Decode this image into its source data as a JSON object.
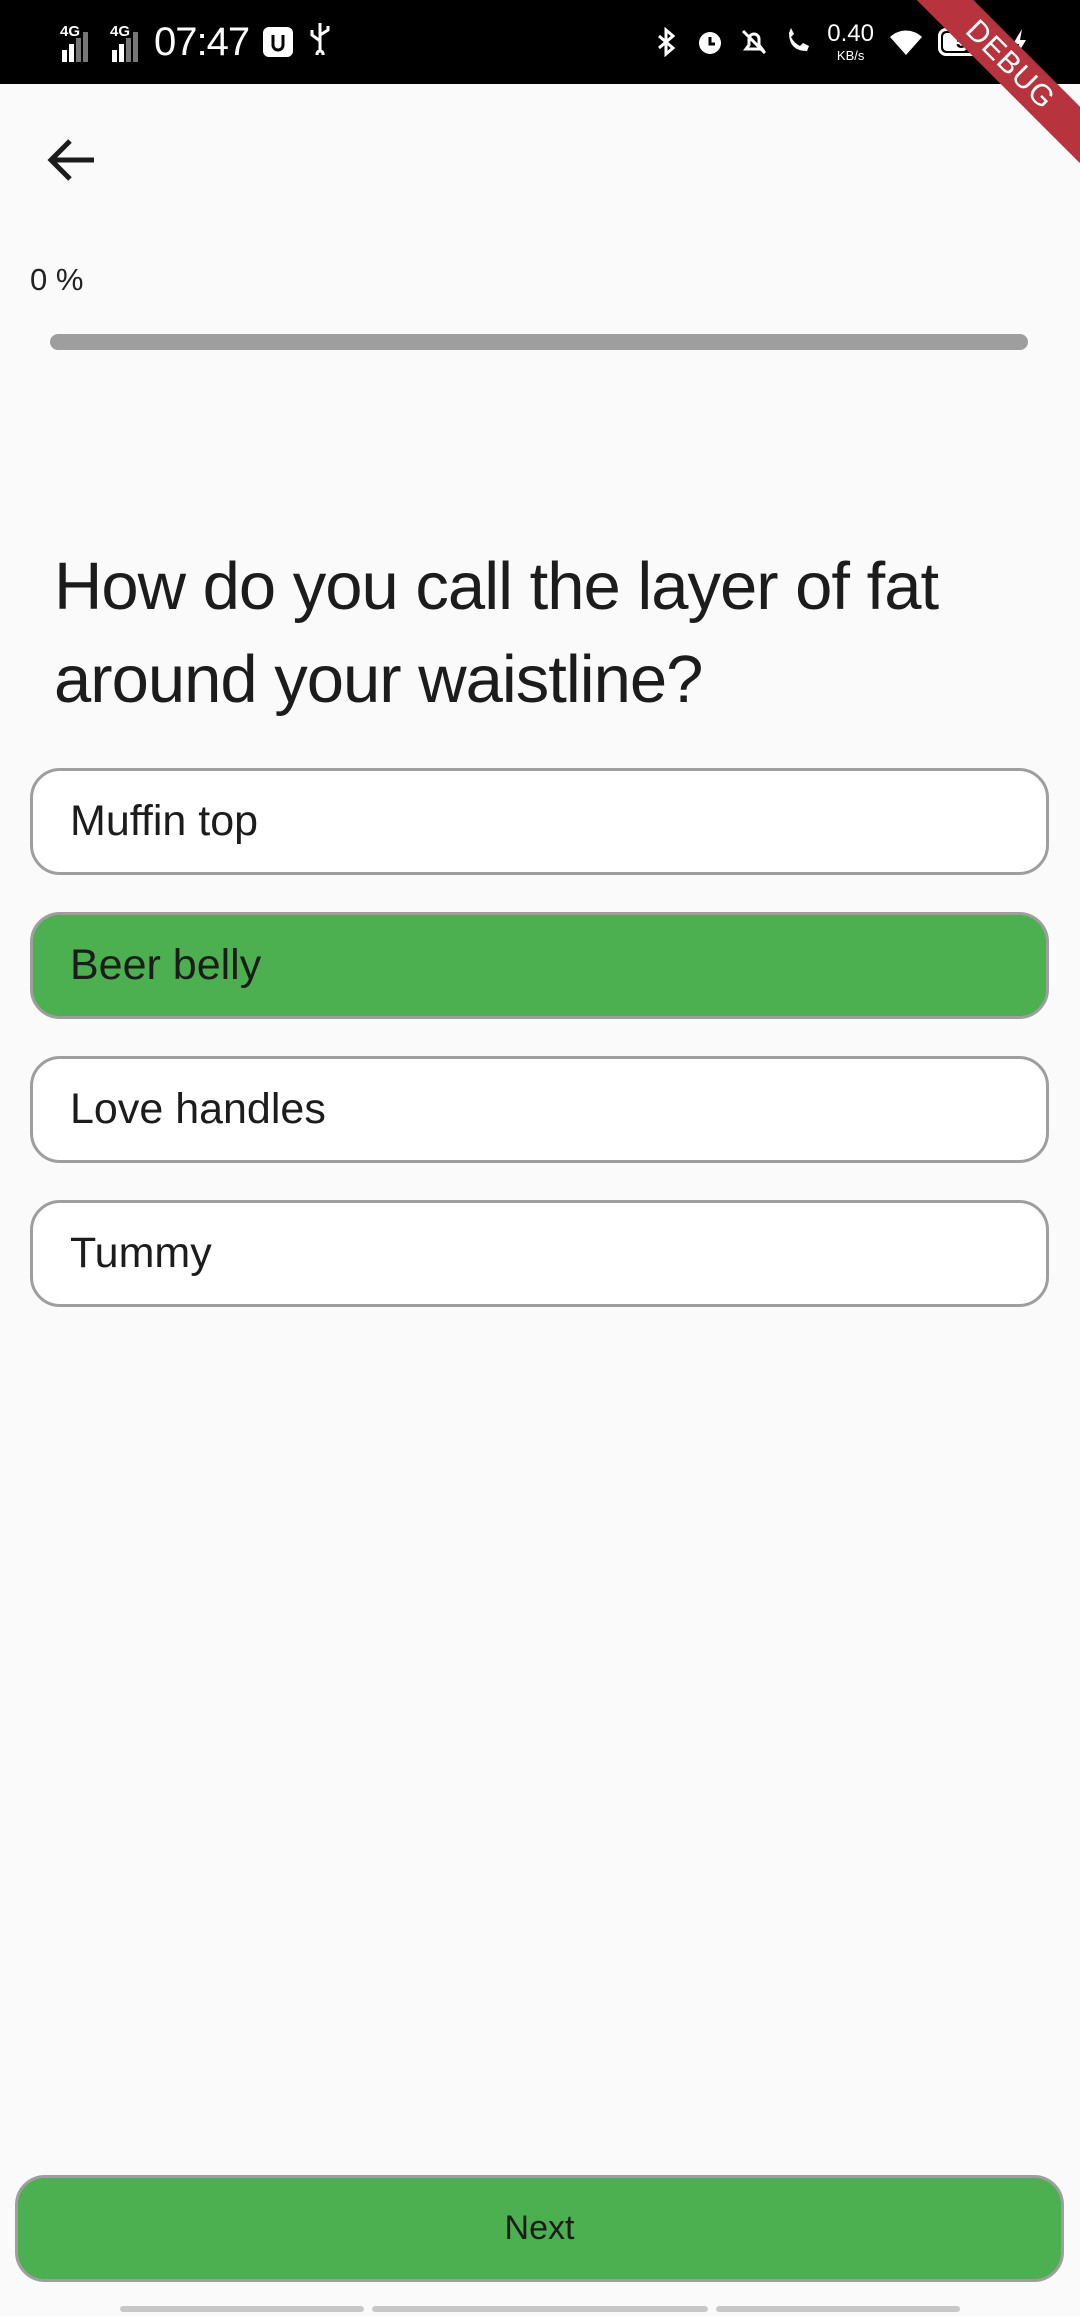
{
  "status_bar": {
    "sim1_network": "4G",
    "sim2_network": "4G",
    "time": "07:47",
    "net_speed_value": "0.40",
    "net_speed_unit": "KB/s",
    "battery_level": "54",
    "battery_fraction": 0.54
  },
  "debug_banner": {
    "label": "DEBUG"
  },
  "header": {
    "progress_label": "0 %",
    "progress_fraction": 0
  },
  "question": {
    "text": "How do you call the layer of fat around your waistline?"
  },
  "options": [
    {
      "label": "Muffin top",
      "selected": false
    },
    {
      "label": "Beer belly",
      "selected": true
    },
    {
      "label": "Love handles",
      "selected": false
    },
    {
      "label": "Tummy",
      "selected": false
    }
  ],
  "footer": {
    "next_label": "Next"
  },
  "colors": {
    "selected": "#4caf50",
    "border": "#9e9e9e",
    "background": "#fafafa",
    "debug_ribbon": "#b7333d"
  }
}
